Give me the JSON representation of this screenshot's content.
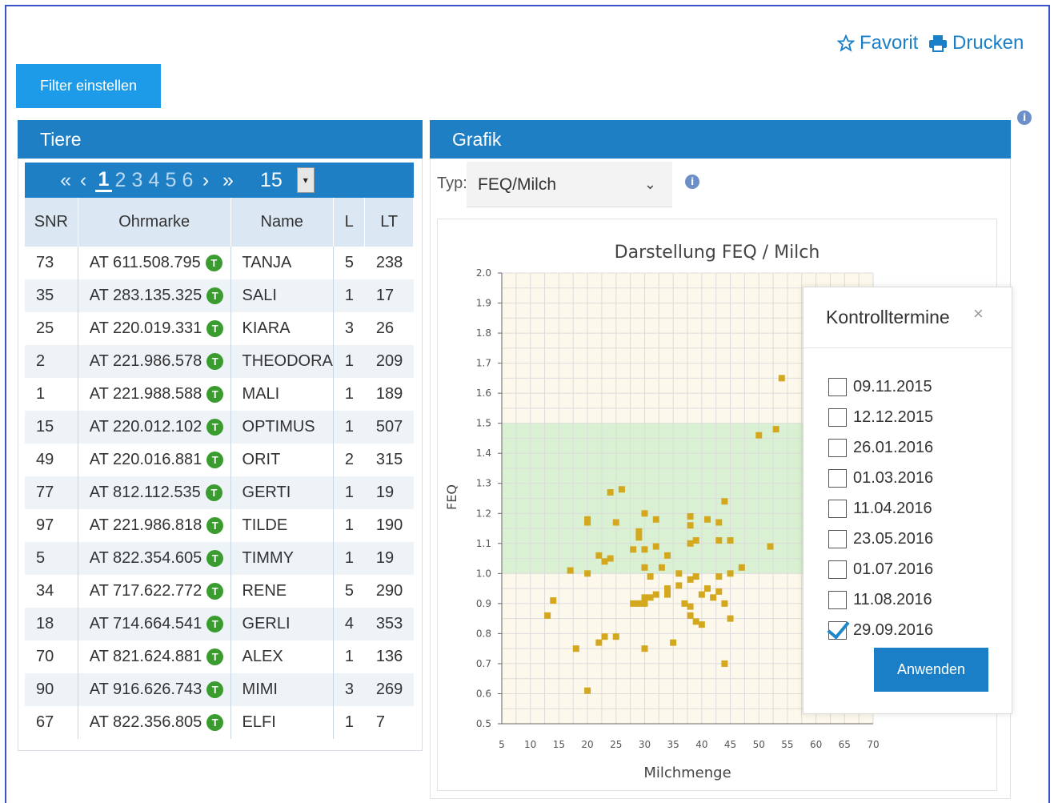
{
  "toolbar": {
    "favorite_label": "Favorit",
    "print_label": "Drucken",
    "filter_label": "Filter einstellen"
  },
  "tiere": {
    "title": "Tiere",
    "pager": {
      "pages": [
        "1",
        "2",
        "3",
        "4",
        "5",
        "6"
      ],
      "active_page": "1",
      "page_size": "15"
    },
    "columns": [
      "SNR",
      "Ohrmarke",
      "Name",
      "L",
      "LT"
    ],
    "rows": [
      {
        "snr": "73",
        "ohrmarke": "AT 611.508.795",
        "name": "TANJA",
        "l": "5",
        "lt": "238"
      },
      {
        "snr": "35",
        "ohrmarke": "AT 283.135.325",
        "name": "SALI",
        "l": "1",
        "lt": "17"
      },
      {
        "snr": "25",
        "ohrmarke": "AT 220.019.331",
        "name": "KIARA",
        "l": "3",
        "lt": "26"
      },
      {
        "snr": "2",
        "ohrmarke": "AT 221.986.578",
        "name": "THEODORA",
        "l": "1",
        "lt": "209"
      },
      {
        "snr": "1",
        "ohrmarke": "AT 221.988.588",
        "name": "MALI",
        "l": "1",
        "lt": "189"
      },
      {
        "snr": "15",
        "ohrmarke": "AT 220.012.102",
        "name": "OPTIMUS",
        "l": "1",
        "lt": "507"
      },
      {
        "snr": "49",
        "ohrmarke": "AT 220.016.881",
        "name": "ORIT",
        "l": "2",
        "lt": "315"
      },
      {
        "snr": "77",
        "ohrmarke": "AT 812.112.535",
        "name": "GERTI",
        "l": "1",
        "lt": "19"
      },
      {
        "snr": "97",
        "ohrmarke": "AT 221.986.818",
        "name": "TILDE",
        "l": "1",
        "lt": "190"
      },
      {
        "snr": "5",
        "ohrmarke": "AT 822.354.605",
        "name": "TIMMY",
        "l": "1",
        "lt": "19"
      },
      {
        "snr": "34",
        "ohrmarke": "AT 717.622.772",
        "name": "RENE",
        "l": "5",
        "lt": "290"
      },
      {
        "snr": "18",
        "ohrmarke": "AT 714.664.541",
        "name": "GERLI",
        "l": "4",
        "lt": "353"
      },
      {
        "snr": "70",
        "ohrmarke": "AT 821.624.881",
        "name": "ALEX",
        "l": "1",
        "lt": "136"
      },
      {
        "snr": "90",
        "ohrmarke": "AT 916.626.743",
        "name": "MIMI",
        "l": "3",
        "lt": "269"
      },
      {
        "snr": "67",
        "ohrmarke": "AT 822.356.805",
        "name": "ELFI",
        "l": "1",
        "lt": "7"
      }
    ]
  },
  "grafik": {
    "title": "Grafik",
    "typ_label": "Typ:",
    "typ_value": "FEQ/Milch"
  },
  "popup": {
    "title": "Kontrolltermine",
    "dates": [
      {
        "label": "09.11.2015",
        "checked": false
      },
      {
        "label": "12.12.2015",
        "checked": false
      },
      {
        "label": "26.01.2016",
        "checked": false
      },
      {
        "label": "01.03.2016",
        "checked": false
      },
      {
        "label": "11.04.2016",
        "checked": false
      },
      {
        "label": "23.05.2016",
        "checked": false
      },
      {
        "label": "01.07.2016",
        "checked": false
      },
      {
        "label": "11.08.2016",
        "checked": false
      },
      {
        "label": "29.09.2016",
        "checked": true
      }
    ],
    "apply_label": "Anwenden"
  },
  "colors": {
    "brand": "#1f7fc4",
    "button": "#1e9be8",
    "points": "#d4a81e",
    "band": "#d9f1d2",
    "plot_bg": "#fdf8ec",
    "tag": "#3a9b2f"
  },
  "chart_data": {
    "type": "scatter",
    "title": "Darstellung FEQ / Milch",
    "xlabel": "Milchmenge",
    "ylabel": "FEQ",
    "xlim": [
      5,
      70
    ],
    "ylim": [
      0.5,
      2.0
    ],
    "xticks": [
      5,
      10,
      15,
      20,
      25,
      30,
      35,
      40,
      45,
      50,
      55,
      60,
      65,
      70
    ],
    "yticks": [
      0.5,
      0.6,
      0.7,
      0.8,
      0.9,
      1.0,
      1.1,
      1.2,
      1.3,
      1.4,
      1.5,
      1.6,
      1.7,
      1.8,
      1.9,
      2.0
    ],
    "normal_band": [
      1.0,
      1.5
    ],
    "grid": true,
    "points": [
      [
        54,
        1.65
      ],
      [
        50,
        1.46
      ],
      [
        53,
        1.48
      ],
      [
        24,
        1.27
      ],
      [
        26,
        1.28
      ],
      [
        20,
        1.17
      ],
      [
        20,
        1.18
      ],
      [
        25,
        1.17
      ],
      [
        30,
        1.2
      ],
      [
        32,
        1.18
      ],
      [
        29,
        1.14
      ],
      [
        29,
        1.12
      ],
      [
        38,
        1.19
      ],
      [
        38,
        1.16
      ],
      [
        41,
        1.18
      ],
      [
        44,
        1.24
      ],
      [
        43,
        1.17
      ],
      [
        45,
        1.11
      ],
      [
        43,
        1.11
      ],
      [
        52,
        1.09
      ],
      [
        61,
        1.18
      ],
      [
        28,
        1.08
      ],
      [
        30,
        1.08
      ],
      [
        32,
        1.09
      ],
      [
        34,
        1.06
      ],
      [
        38,
        1.1
      ],
      [
        39,
        1.11
      ],
      [
        24,
        1.05
      ],
      [
        23,
        1.04
      ],
      [
        22,
        1.06
      ],
      [
        17,
        1.01
      ],
      [
        20,
        1.0
      ],
      [
        30,
        1.02
      ],
      [
        31,
        0.99
      ],
      [
        33,
        1.02
      ],
      [
        36,
        1.0
      ],
      [
        38,
        0.98
      ],
      [
        39,
        0.99
      ],
      [
        36,
        0.96
      ],
      [
        34,
        0.95
      ],
      [
        34,
        0.93
      ],
      [
        31,
        0.92
      ],
      [
        32,
        0.93
      ],
      [
        30,
        0.9
      ],
      [
        29,
        0.9
      ],
      [
        30,
        0.92
      ],
      [
        28,
        0.9
      ],
      [
        41,
        0.95
      ],
      [
        42,
        0.92
      ],
      [
        43,
        0.94
      ],
      [
        43,
        0.99
      ],
      [
        45,
        1.0
      ],
      [
        47,
        1.02
      ],
      [
        40,
        0.93
      ],
      [
        38,
        0.89
      ],
      [
        38,
        0.86
      ],
      [
        39,
        0.84
      ],
      [
        40,
        0.83
      ],
      [
        37,
        0.9
      ],
      [
        45,
        0.85
      ],
      [
        44,
        0.9
      ],
      [
        13,
        0.86
      ],
      [
        14,
        0.91
      ],
      [
        18,
        0.75
      ],
      [
        22,
        0.77
      ],
      [
        23,
        0.79
      ],
      [
        25,
        0.79
      ],
      [
        30,
        0.75
      ],
      [
        35,
        0.77
      ],
      [
        20,
        0.61
      ],
      [
        44,
        0.7
      ]
    ]
  }
}
